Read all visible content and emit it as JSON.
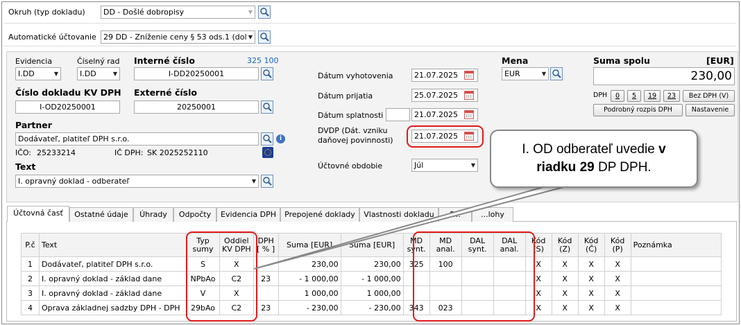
{
  "okruh": {
    "label": "Okruh (typ dokladu)",
    "value": "DD - Došlé dobropisy"
  },
  "auto_uct": {
    "label": "Automatické účtovanie",
    "value": "29 DD - Zníženie  ceny § 53 ods.1 (dol"
  },
  "evidencia": {
    "label": "Evidencia",
    "value": "I.DD"
  },
  "ciselny_rad": {
    "label": "Číselný rad",
    "value": "I.DD"
  },
  "interne_cislo": {
    "label": "Interné číslo",
    "nums": "325  100",
    "value": "I-DD20250001"
  },
  "cislo_kv": {
    "label": "Číslo dokladu KV DPH",
    "value": "I-OD20250001"
  },
  "externe_cislo": {
    "label": "Externé číslo",
    "value": "20250001"
  },
  "partner": {
    "label": "Partner",
    "value": "Dodávateľ, platiteľ DPH s.r.o.",
    "ico_label": "IČO:",
    "ico": "25233214",
    "icdph_label": "IČ DPH:",
    "icdph": "SK 2025252110"
  },
  "text": {
    "label": "Text",
    "value": "I. opravný doklad - odberateľ"
  },
  "dates": {
    "vyhotovenia_label": "Dátum vyhotovenia",
    "vyhotovenia": "21.07.2025",
    "prijatia_label": "Dátum prijatia",
    "prijatia": "25.07.2025",
    "splatnosti_label": "Dátum splatnosti",
    "splatnosti": "21.07.2025",
    "dvdp_label1": "DVDP (Dát. vzniku",
    "dvdp_label2": "daňovej povinnosti)",
    "dvdp": "21.07.2025",
    "obdobie_label": "Účtovné obdobie",
    "obdobie": "Júl"
  },
  "mena": {
    "label": "Mena",
    "value": "EUR"
  },
  "suma": {
    "label": "Suma spolu",
    "unit": "[EUR]",
    "value": "230,00"
  },
  "dph_buttons": {
    "label": "DPH",
    "b0": "0",
    "b5": "5",
    "b19": "19",
    "b23": "23",
    "bez": "Bez DPH (V)"
  },
  "podrobny": "Podrobný rozpis DPH",
  "nastavenie": "Nastavenie",
  "callout": {
    "line1a": "I. OD odberateľ uvedie ",
    "line1b": "v",
    "line2a": "riadku 29",
    "line2b": " DP DPH."
  },
  "tabs": [
    "Účtovná časť",
    "Ostatné údaje",
    "Úhrady",
    "Odpočty",
    "Evidencia DPH",
    "Prepojené doklady",
    "Vlastnosti dokladu",
    "P...",
    "...lohy"
  ],
  "columns": {
    "pc": "P.č",
    "text": "Text",
    "typ1": "Typ",
    "typ2": "sumy",
    "oddiel1": "Oddiel",
    "oddiel2": "KV DPH",
    "dph1": "DPH",
    "dph2": "[ % ]",
    "suma": "Suma [EUR]",
    "suma2": "Suma [EUR]",
    "mds1": "MD",
    "mds2": "synt.",
    "mda1": "MD",
    "mda2": "anal.",
    "dals1": "DAL",
    "dals2": "synt.",
    "dala1": "DAL",
    "dala2": "anal.",
    "ks1": "Kód",
    "ks2": "(S)",
    "kz1": "Kód",
    "kz2": "(Z)",
    "kc1": "Kód",
    "kc2": "(Č)",
    "kp1": "Kód",
    "kp2": "(P)",
    "pozn": "Poznámka"
  },
  "rows": [
    {
      "n": "1",
      "text": "Dodávateľ, platiteľ DPH s.r.o.",
      "typ": "S",
      "oddiel": "X",
      "dph": "",
      "suma": "230,00",
      "suma2": "230,00",
      "mds": "325",
      "mda": "100",
      "dals": "",
      "dala": "",
      "ks": "X",
      "kz": "X",
      "kc": "X",
      "kp": "X"
    },
    {
      "n": "2",
      "text": "I. opravný doklad - základ dane",
      "typ": "NPbAo",
      "oddiel": "C2",
      "dph": "23",
      "suma": "- 1 000,00",
      "suma2": "- 1 000,00",
      "mds": "",
      "mda": "",
      "dals": "",
      "dala": "",
      "ks": "X",
      "kz": "X",
      "kc": "X",
      "kp": "X"
    },
    {
      "n": "3",
      "text": "I. opravný doklad - základ dane",
      "typ": "V",
      "oddiel": "X",
      "dph": "",
      "suma": "1 000,00",
      "suma2": "1 000,00",
      "mds": "",
      "mda": "",
      "dals": "",
      "dala": "",
      "ks": "X",
      "kz": "X",
      "kc": "X",
      "kp": "X"
    },
    {
      "n": "4",
      "text": "Oprava základnej sadzby DPH - DPH",
      "typ": "29bAo",
      "oddiel": "C2",
      "dph": "23",
      "suma": "- 230,00",
      "suma2": "- 230,00",
      "mds": "343",
      "mda": "023",
      "dals": "",
      "dala": "",
      "ks": "X",
      "kz": "X",
      "kc": "X",
      "kp": "X"
    }
  ],
  "colors": {
    "highlight": "#e01b1b",
    "link": "#1a63c4"
  }
}
